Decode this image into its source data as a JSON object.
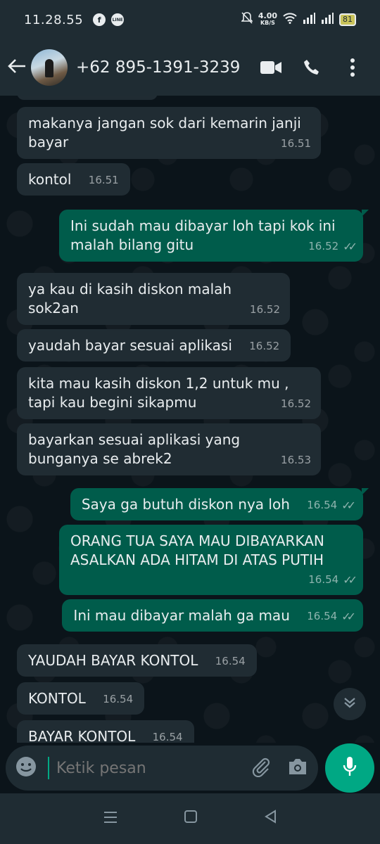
{
  "status_bar": {
    "time": "11.28.55",
    "app_icons": [
      "f",
      "LINE",
      "chat"
    ],
    "net_speed_value": "4.00",
    "net_speed_unit": "KB/S",
    "battery": "81"
  },
  "header": {
    "contact": "+62 895-1391-3239"
  },
  "messages": [
    {
      "dir": "in",
      "text": "makanya jangan sok dari kemarin janji bayar",
      "time": "16.51"
    },
    {
      "dir": "in",
      "text": "kontol",
      "time": "16.51"
    },
    {
      "dir": "out",
      "text": "Ini sudah mau dibayar loh tapi kok ini malah bilang gitu",
      "time": "16.52"
    },
    {
      "dir": "in",
      "text": "ya kau di kasih diskon malah sok2an",
      "time": "16.52"
    },
    {
      "dir": "in",
      "text": "yaudah bayar sesuai aplikasi",
      "time": "16.52"
    },
    {
      "dir": "in",
      "text": "kita mau kasih diskon 1,2 untuk mu , tapi kau begini sikapmu",
      "time": "16.52"
    },
    {
      "dir": "in",
      "text": "bayarkan sesuai aplikasi yang bunganya se abrek2",
      "time": "16.53"
    },
    {
      "dir": "out",
      "text": "Saya ga butuh diskon nya loh",
      "time": "16.54"
    },
    {
      "dir": "out",
      "text": "ORANG TUA SAYA MAU DIBAYARKAN ASALKAN ADA HITAM DI ATAS PUTIH",
      "time": "16.54"
    },
    {
      "dir": "out",
      "text": "Ini mau dibayar malah ga mau",
      "time": "16.54"
    },
    {
      "dir": "in",
      "text": "YAUDAH BAYAR KONTOL",
      "time": "16.54"
    },
    {
      "dir": "in",
      "text": "KONTOL",
      "time": "16.54"
    },
    {
      "dir": "in",
      "text": "BAYAR KONTOL",
      "time": "16.54"
    }
  ],
  "input": {
    "placeholder": "Ketik pesan"
  },
  "colors": {
    "incoming_bubble": "#202c33",
    "outgoing_bubble": "#005c4b",
    "accent": "#00a884",
    "background": "#0b141a",
    "bar": "#1f2c33"
  },
  "icons": {
    "back": "arrow-left-icon",
    "video": "video-camera-icon",
    "call": "phone-icon",
    "menu": "more-vertical-icon",
    "emoji": "emoji-icon",
    "attach": "paperclip-icon",
    "camera": "camera-icon",
    "mic": "microphone-icon",
    "scroll": "chevron-double-down-icon"
  }
}
